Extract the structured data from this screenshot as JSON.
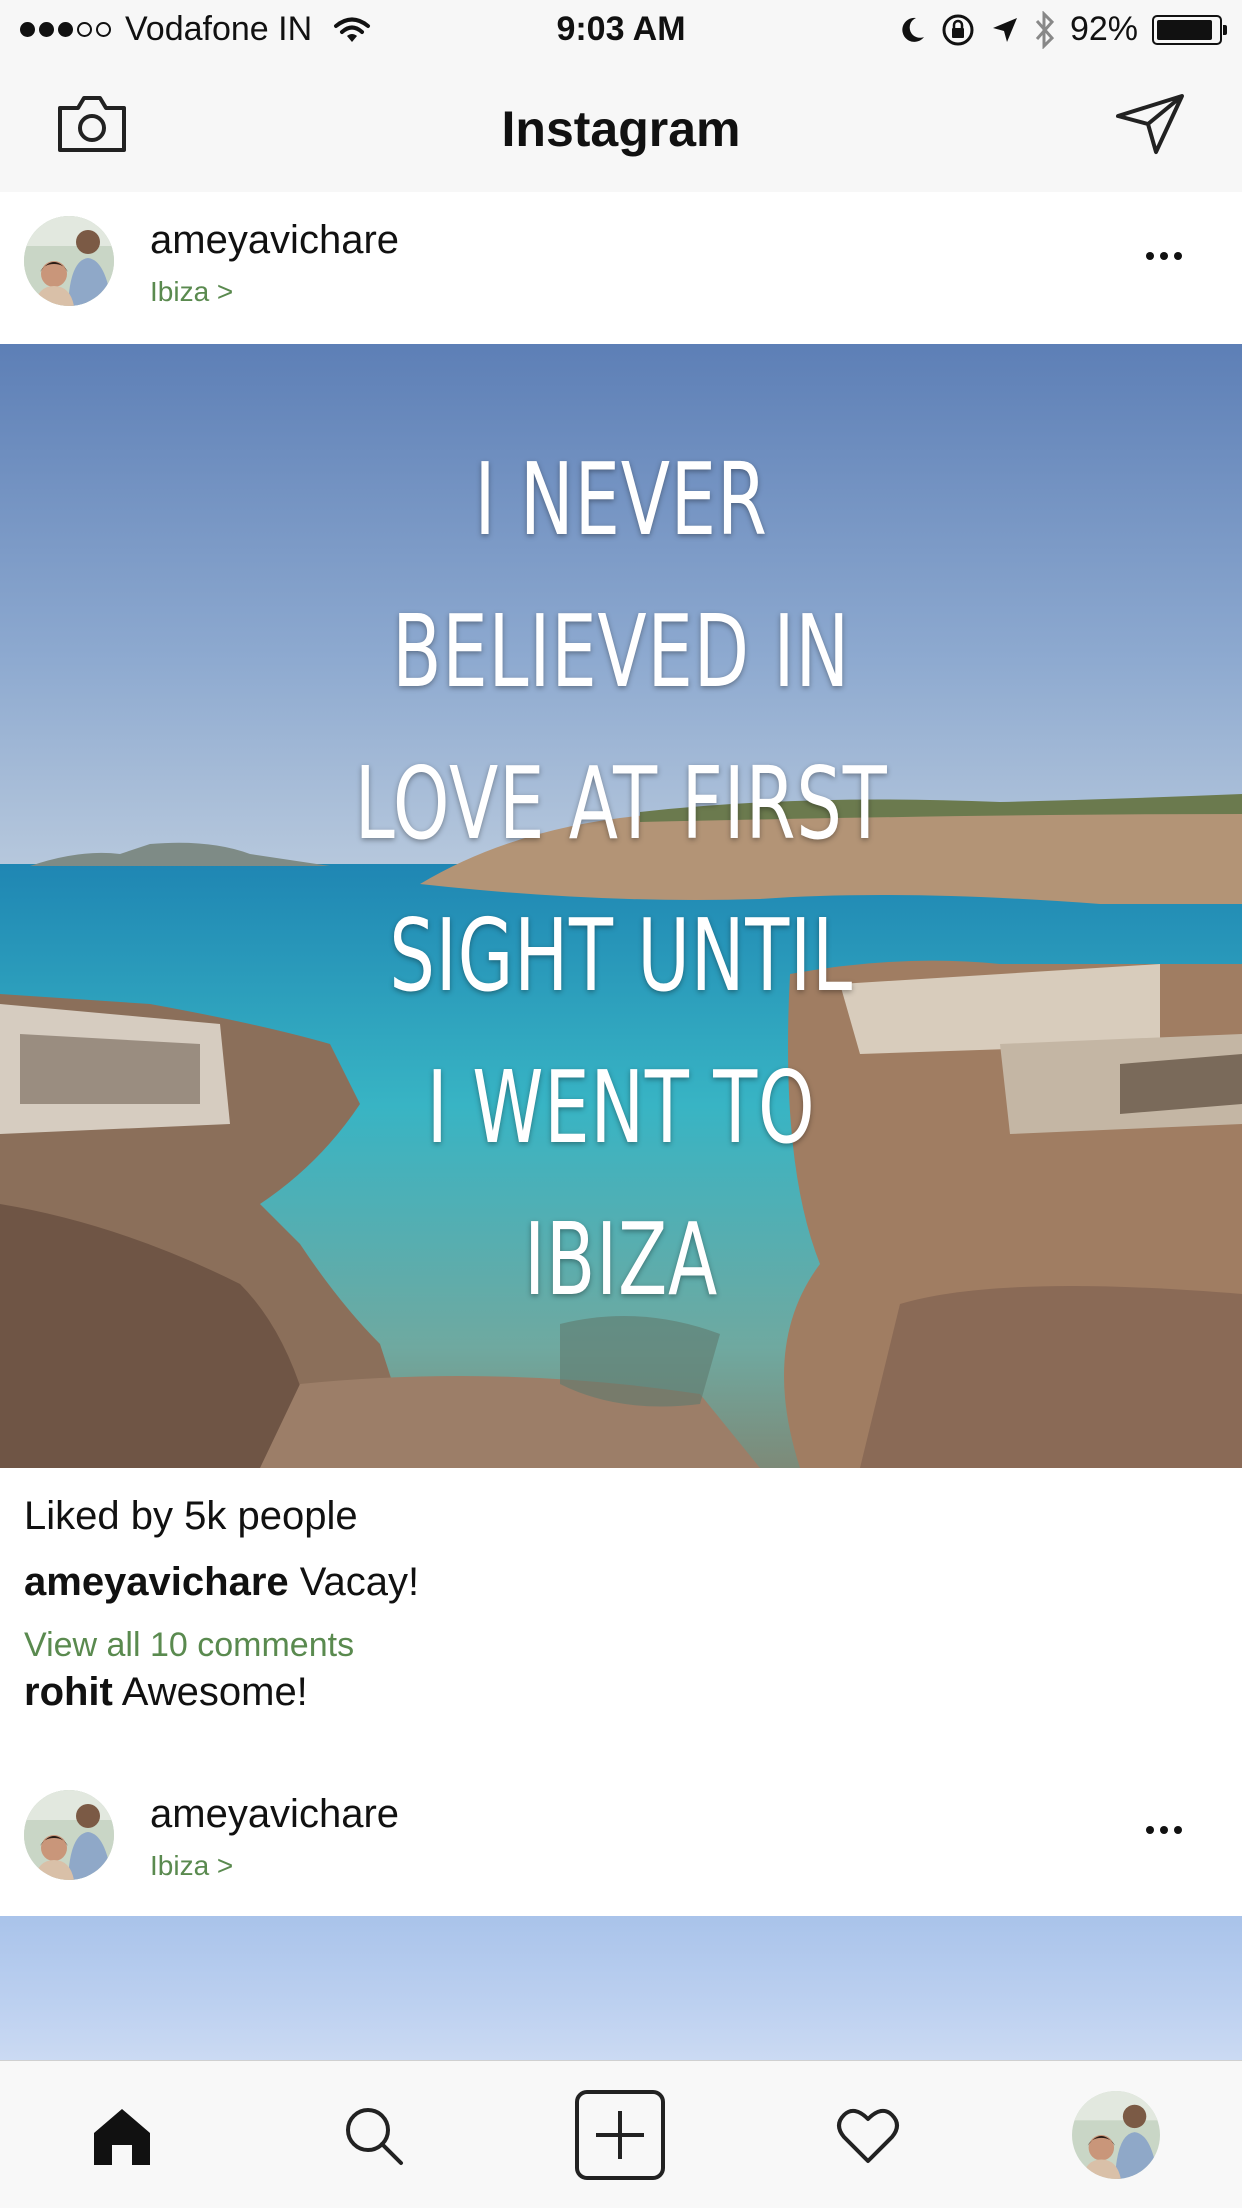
{
  "status_bar": {
    "carrier": "Vodafone IN",
    "time": "9:03 AM",
    "battery": "92%"
  },
  "nav": {
    "title": "Instagram",
    "left_icon": "camera-icon",
    "right_icon": "direct-message-icon"
  },
  "posts": [
    {
      "username": "ameyavichare",
      "location": "Ibiza >",
      "image_text_lines": [
        "I NEVER",
        "BELIEVED IN",
        "LOVE AT FIRST",
        "SIGHT UNTIL",
        "I WENT TO",
        "IBIZA"
      ],
      "likes": "Liked by 5k people",
      "caption_user": "ameyavichare",
      "caption_text": " Vacay!",
      "view_comments": "View all 10 comments",
      "comment_user": "rohit",
      "comment_text": " Awesome!"
    },
    {
      "username": "ameyavichare",
      "location": "Ibiza >"
    }
  ],
  "tab_bar": {
    "items": [
      "home-icon",
      "search-icon",
      "add-post-icon",
      "heart-icon",
      "profile-avatar"
    ]
  },
  "colors": {
    "link_green": "#5a8a4f",
    "bar_background": "#f7f7f7"
  }
}
